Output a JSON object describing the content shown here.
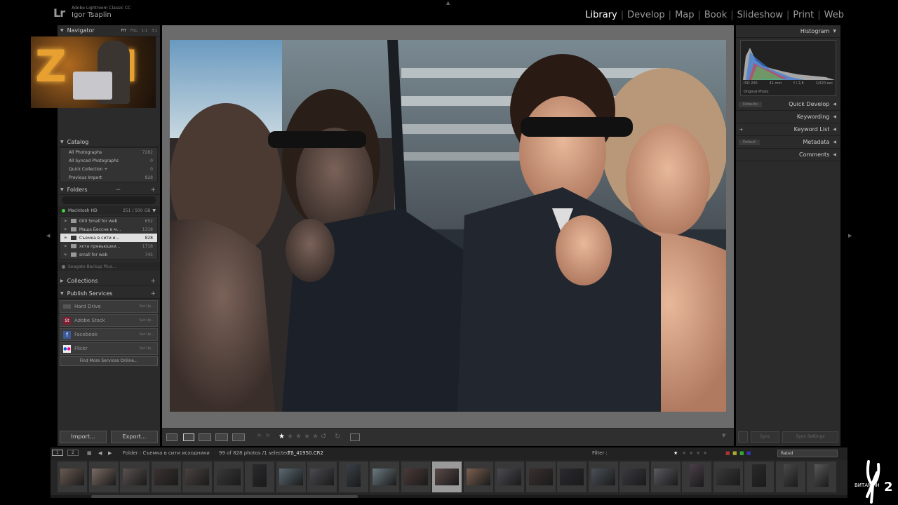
{
  "app": {
    "logo": "Lr",
    "name": "Adobe Lightroom Classic CC",
    "user": "Igor Tsaplin"
  },
  "modules": [
    {
      "label": "Library",
      "active": true
    },
    {
      "label": "Develop"
    },
    {
      "label": "Map"
    },
    {
      "label": "Book"
    },
    {
      "label": "Slideshow"
    },
    {
      "label": "Print"
    },
    {
      "label": "Web"
    }
  ],
  "navigator": {
    "title": "Navigator",
    "options": [
      "FIT",
      "FILL",
      "1:1",
      "3:1"
    ]
  },
  "catalog": {
    "title": "Catalog",
    "items": [
      {
        "label": "All Photographs",
        "count": "7282"
      },
      {
        "label": "All Synced Photographs",
        "count": "0"
      },
      {
        "label": "Quick Collection +",
        "count": "0"
      },
      {
        "label": "Previous Import",
        "count": "828"
      }
    ]
  },
  "folders": {
    "title": "Folders",
    "volume": {
      "name": "Macintosh HD",
      "space": "251 / 500 GB"
    },
    "items": [
      {
        "label": "000 Small for web",
        "count": "652"
      },
      {
        "label": "Маша Бессна в м...",
        "count": "1318"
      },
      {
        "label": "Съемка в сити и...",
        "count": "828",
        "selected": true
      },
      {
        "label": "хкта превьюшки...",
        "count": "1718"
      },
      {
        "label": "small for web",
        "count": "745"
      }
    ],
    "volume2": "Seagate Backup Plus..."
  },
  "collections": {
    "title": "Collections"
  },
  "publish": {
    "title": "Publish Services",
    "services": [
      {
        "label": "Hard Drive",
        "setup": "Set Up..."
      },
      {
        "label": "Adobe Stock",
        "setup": "Set Up..."
      },
      {
        "label": "Facebook",
        "setup": "Set Up..."
      },
      {
        "label": "Flickr",
        "setup": "Set Up..."
      }
    ],
    "find_more": "Find More Services Online..."
  },
  "left_buttons": {
    "import": "Import...",
    "export": "Export..."
  },
  "right": {
    "histogram": "Histogram",
    "iso": "ISO 200",
    "focal": "41 mm",
    "aperture": "f / 2,8",
    "shutter": "1/320 sec",
    "original": "Original Photo",
    "quick_develop": "Quick Develop",
    "qd_preset": "Defaults",
    "keywording": "Keywording",
    "keyword_list": "Keyword List",
    "metadata": "Metadata",
    "md_preset": "Default",
    "comments": "Comments",
    "sync": "Sync",
    "sync_settings": "Sync Settings"
  },
  "filmstrip": {
    "pages": [
      "1",
      "2"
    ],
    "source": "Folder : Съемка в сити исходники",
    "info": "99 of 828 photos /1 selected /",
    "filename": "TS_41950.CR2",
    "filter_label": "Filter :",
    "filter_value": "Rated",
    "rating": 1
  },
  "watermark": "ВИТАМИН",
  "colors": {
    "accent": "#ffffff",
    "panel": "#2b2b2b",
    "selected": "#e0e0e0"
  }
}
